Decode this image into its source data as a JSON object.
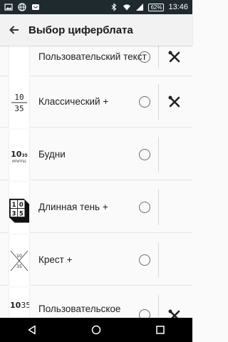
{
  "status_bar": {
    "time": "13:46",
    "battery": "62%",
    "icons": [
      "image-icon",
      "globe-icon",
      "messenger-icon",
      "bluetooth-icon",
      "wifi-icon",
      "signal-icon",
      "battery-icon"
    ]
  },
  "app_bar": {
    "title": "Выбор циферблата",
    "back_icon": "arrow-back-icon"
  },
  "watchfaces": [
    {
      "label": "Пользовательский текст",
      "thumb_text": "",
      "has_settings": true,
      "selected": false
    },
    {
      "label": "Классический +",
      "thumb_text": "10 35",
      "has_settings": true,
      "selected": false
    },
    {
      "label": "Будни",
      "thumb_text": "10 35 MTWTFSS",
      "has_settings": false,
      "selected": false
    },
    {
      "label": "Длинная тень +",
      "thumb_text": "10 35",
      "has_settings": false,
      "selected": false
    },
    {
      "label": "Крест +",
      "thumb_text": "10 35",
      "has_settings": false,
      "selected": false
    },
    {
      "label": "Пользовательское",
      "thumb_text": "10 35",
      "has_settings": true,
      "selected": false
    }
  ],
  "nav_bar": {
    "buttons": [
      "back-triangle-icon",
      "home-circle-icon",
      "recents-square-icon"
    ]
  },
  "colors": {
    "status_bar": "#1f2a2e",
    "app_bar": "#f2f2f2",
    "background": "#fafafa",
    "nav_bar": "#000000"
  }
}
